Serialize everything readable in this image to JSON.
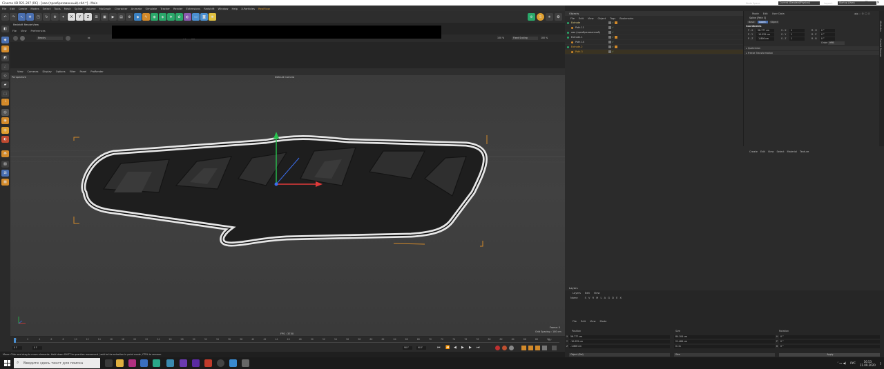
{
  "window": {
    "title": "Cinema 4D R21.207 (RC) - [ааа (преобразованный).c4d *] - Main",
    "controls": [
      "—",
      "□",
      "✕"
    ]
  },
  "menubar": [
    "File",
    "Edit",
    "Create",
    "Modes",
    "Select",
    "Tools",
    "Mesh",
    "Spline",
    "Volume",
    "MoGraph",
    "Character",
    "Animate",
    "Simulate",
    "Tracker",
    "Render",
    "Extensions",
    "Redshift",
    "Window",
    "Help",
    "X-Particles",
    "RealFlow"
  ],
  "layout": {
    "node_space_label": "Node Space:",
    "node_space_value": "Current (Standard/Physical)",
    "layout_label": "Layout:",
    "layout_value": "Startup (User)"
  },
  "render_view": {
    "title": "Redshift RenderView",
    "menu": [
      "File",
      "View",
      "Preferences"
    ],
    "dropdown": "Beauty",
    "zoom1": "100 %",
    "fit_mode": "Fixed Scaling",
    "zoom2": "100 %"
  },
  "viewport": {
    "menu": [
      "View",
      "Cameras",
      "Display",
      "Options",
      "Filter",
      "Panel",
      "ProRender"
    ],
    "view_name": "Perspective",
    "camera": "Default Camera",
    "fps": "FPS : 3750",
    "frame": "Frame: 0",
    "grid_spacing": "Grid Spacing : 100 cm"
  },
  "timeline": {
    "ticks": [
      "0",
      "2",
      "4",
      "6",
      "8",
      "10",
      "12",
      "14",
      "16",
      "18",
      "20",
      "22",
      "24",
      "26",
      "28",
      "30",
      "32",
      "34",
      "36",
      "38",
      "40",
      "42",
      "44",
      "46",
      "48",
      "50",
      "52",
      "54",
      "56",
      "58",
      "60",
      "62",
      "64",
      "66",
      "68",
      "70",
      "72",
      "74",
      "76",
      "78",
      "80",
      "82",
      "84",
      "86",
      "88",
      "90"
    ],
    "end_label": "0 F",
    "start_field": "0 F",
    "start_field2": "0 F",
    "end_field": "90 F",
    "end_field2": "90 F"
  },
  "status": "Move: Click and drag to move elements. Hold down SHIFT to quantize movement / add to the selection in point mode, CTRL to remove.",
  "objects": {
    "title": "Objects",
    "menu": [
      "File",
      "Edit",
      "View",
      "Object",
      "Tags",
      "Bookmarks"
    ],
    "rows": [
      {
        "name": "Extrude",
        "indent": 0,
        "color": "#e8d68a"
      },
      {
        "name": "Path 11",
        "indent": 1,
        "color": "#c0c0c0"
      },
      {
        "name": "ааа (преобразованный)",
        "indent": 0,
        "color": "#c0c0c0"
      },
      {
        "name": "Extrude.1",
        "indent": 0,
        "color": "#c0c0c0"
      },
      {
        "name": "Path 14",
        "indent": 1,
        "color": "#c0c0c0"
      },
      {
        "name": "Extrude.2",
        "indent": 0,
        "color": "#e0a030"
      },
      {
        "name": "Path 3",
        "indent": 1,
        "color": "#e0a030"
      }
    ]
  },
  "attributes": {
    "menu": [
      "Mode",
      "Edit",
      "User Data"
    ],
    "object_name": "Spline [Path 3]",
    "tabs": [
      "Basic",
      "Coord.",
      "Object"
    ],
    "section": "Coordinates",
    "rows": [
      {
        "axis": "P . X",
        "pv": "56.777 cm",
        "saxis": "S . X",
        "sv": "1",
        "raxis": "R . H",
        "rv": "0 °"
      },
      {
        "axis": "P . Y",
        "pv": "-10.055 cm",
        "saxis": "S . Y",
        "sv": "1",
        "raxis": "R . P",
        "rv": "0 °"
      },
      {
        "axis": "P . Z",
        "pv": "-1.806 cm",
        "saxis": "S . Z",
        "sv": "1",
        "raxis": "R . B",
        "rv": "0 °"
      }
    ],
    "order_label": "Order",
    "order_value": "HPB",
    "groups": [
      "Quaternion",
      "Freeze Transformation"
    ],
    "side_tabs": [
      "Attributes",
      "Content Browser"
    ]
  },
  "mat_menu": [
    "Create",
    "Edit",
    "View",
    "Select",
    "Material",
    "Texture"
  ],
  "layers": {
    "title": "Layers",
    "menu": [
      "Layers",
      "Edit",
      "View"
    ],
    "header_name": "Name",
    "header_cols": "S V R M L A G D E X"
  },
  "coord_mgr": {
    "menu": [
      "File",
      "Edit",
      "View",
      "Mode"
    ],
    "headers": [
      "Position",
      "Size",
      "Rotation"
    ],
    "rows": [
      {
        "a": "X",
        "p": "56.777 cm",
        "s": "84.104 cm",
        "r": "H",
        "rv": "0 °"
      },
      {
        "a": "Y",
        "p": "-10.055 cm",
        "s": "21.484 cm",
        "r": "P",
        "rv": "0 °"
      },
      {
        "a": "Z",
        "p": "-1.806 cm",
        "s": "0 cm",
        "r": "B",
        "rv": "0 °"
      }
    ],
    "mode1": "Object (Rel)",
    "mode2": "Size",
    "apply": "Apply"
  },
  "taskbar": {
    "search": "Введите здесь текст для поиска",
    "time": "16:53",
    "date": "11.09.2020",
    "lang": "РУС"
  },
  "colors": {
    "accent_orange": "#e0a030",
    "axis_green": "#27c44e",
    "axis_red": "#e03a3a",
    "axis_blue": "#3a6ef0",
    "selection_orange": "#d38a2a"
  }
}
